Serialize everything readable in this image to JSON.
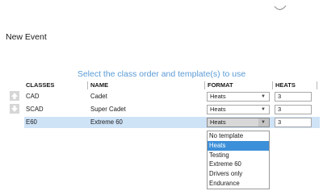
{
  "window": {
    "title": "New Event"
  },
  "instructions": "Select the class order and template(s) to use",
  "table": {
    "columns": [
      "CLASSES",
      "NAME",
      "FORMAT",
      "HEATS"
    ],
    "rows": [
      {
        "class": "CAD",
        "name": "Cadet",
        "format": "Heats",
        "heats": "3",
        "selected": false
      },
      {
        "class": "SCAD",
        "name": "Super Cadet",
        "format": "Heats",
        "heats": "3",
        "selected": false
      },
      {
        "class": "E60",
        "name": "Extreme 60",
        "format": "Heats",
        "heats": "3",
        "selected": true
      }
    ]
  },
  "format_dropdown": {
    "options": [
      "No template",
      "Heats",
      "Testing",
      "Extreme 60",
      "Drivers only",
      "Endurance"
    ],
    "highlighted": "Heats"
  },
  "icons": {
    "move_up": "arrow-up-icon",
    "move_down": "arrow-down-icon",
    "dropdown_caret": "chevron-down-icon"
  },
  "colors": {
    "accent": "#5b9bd5",
    "selected_row": "#cfe3f7",
    "dropdown_highlight": "#3c8fd9",
    "order_arrows": "#c8c8c8"
  }
}
